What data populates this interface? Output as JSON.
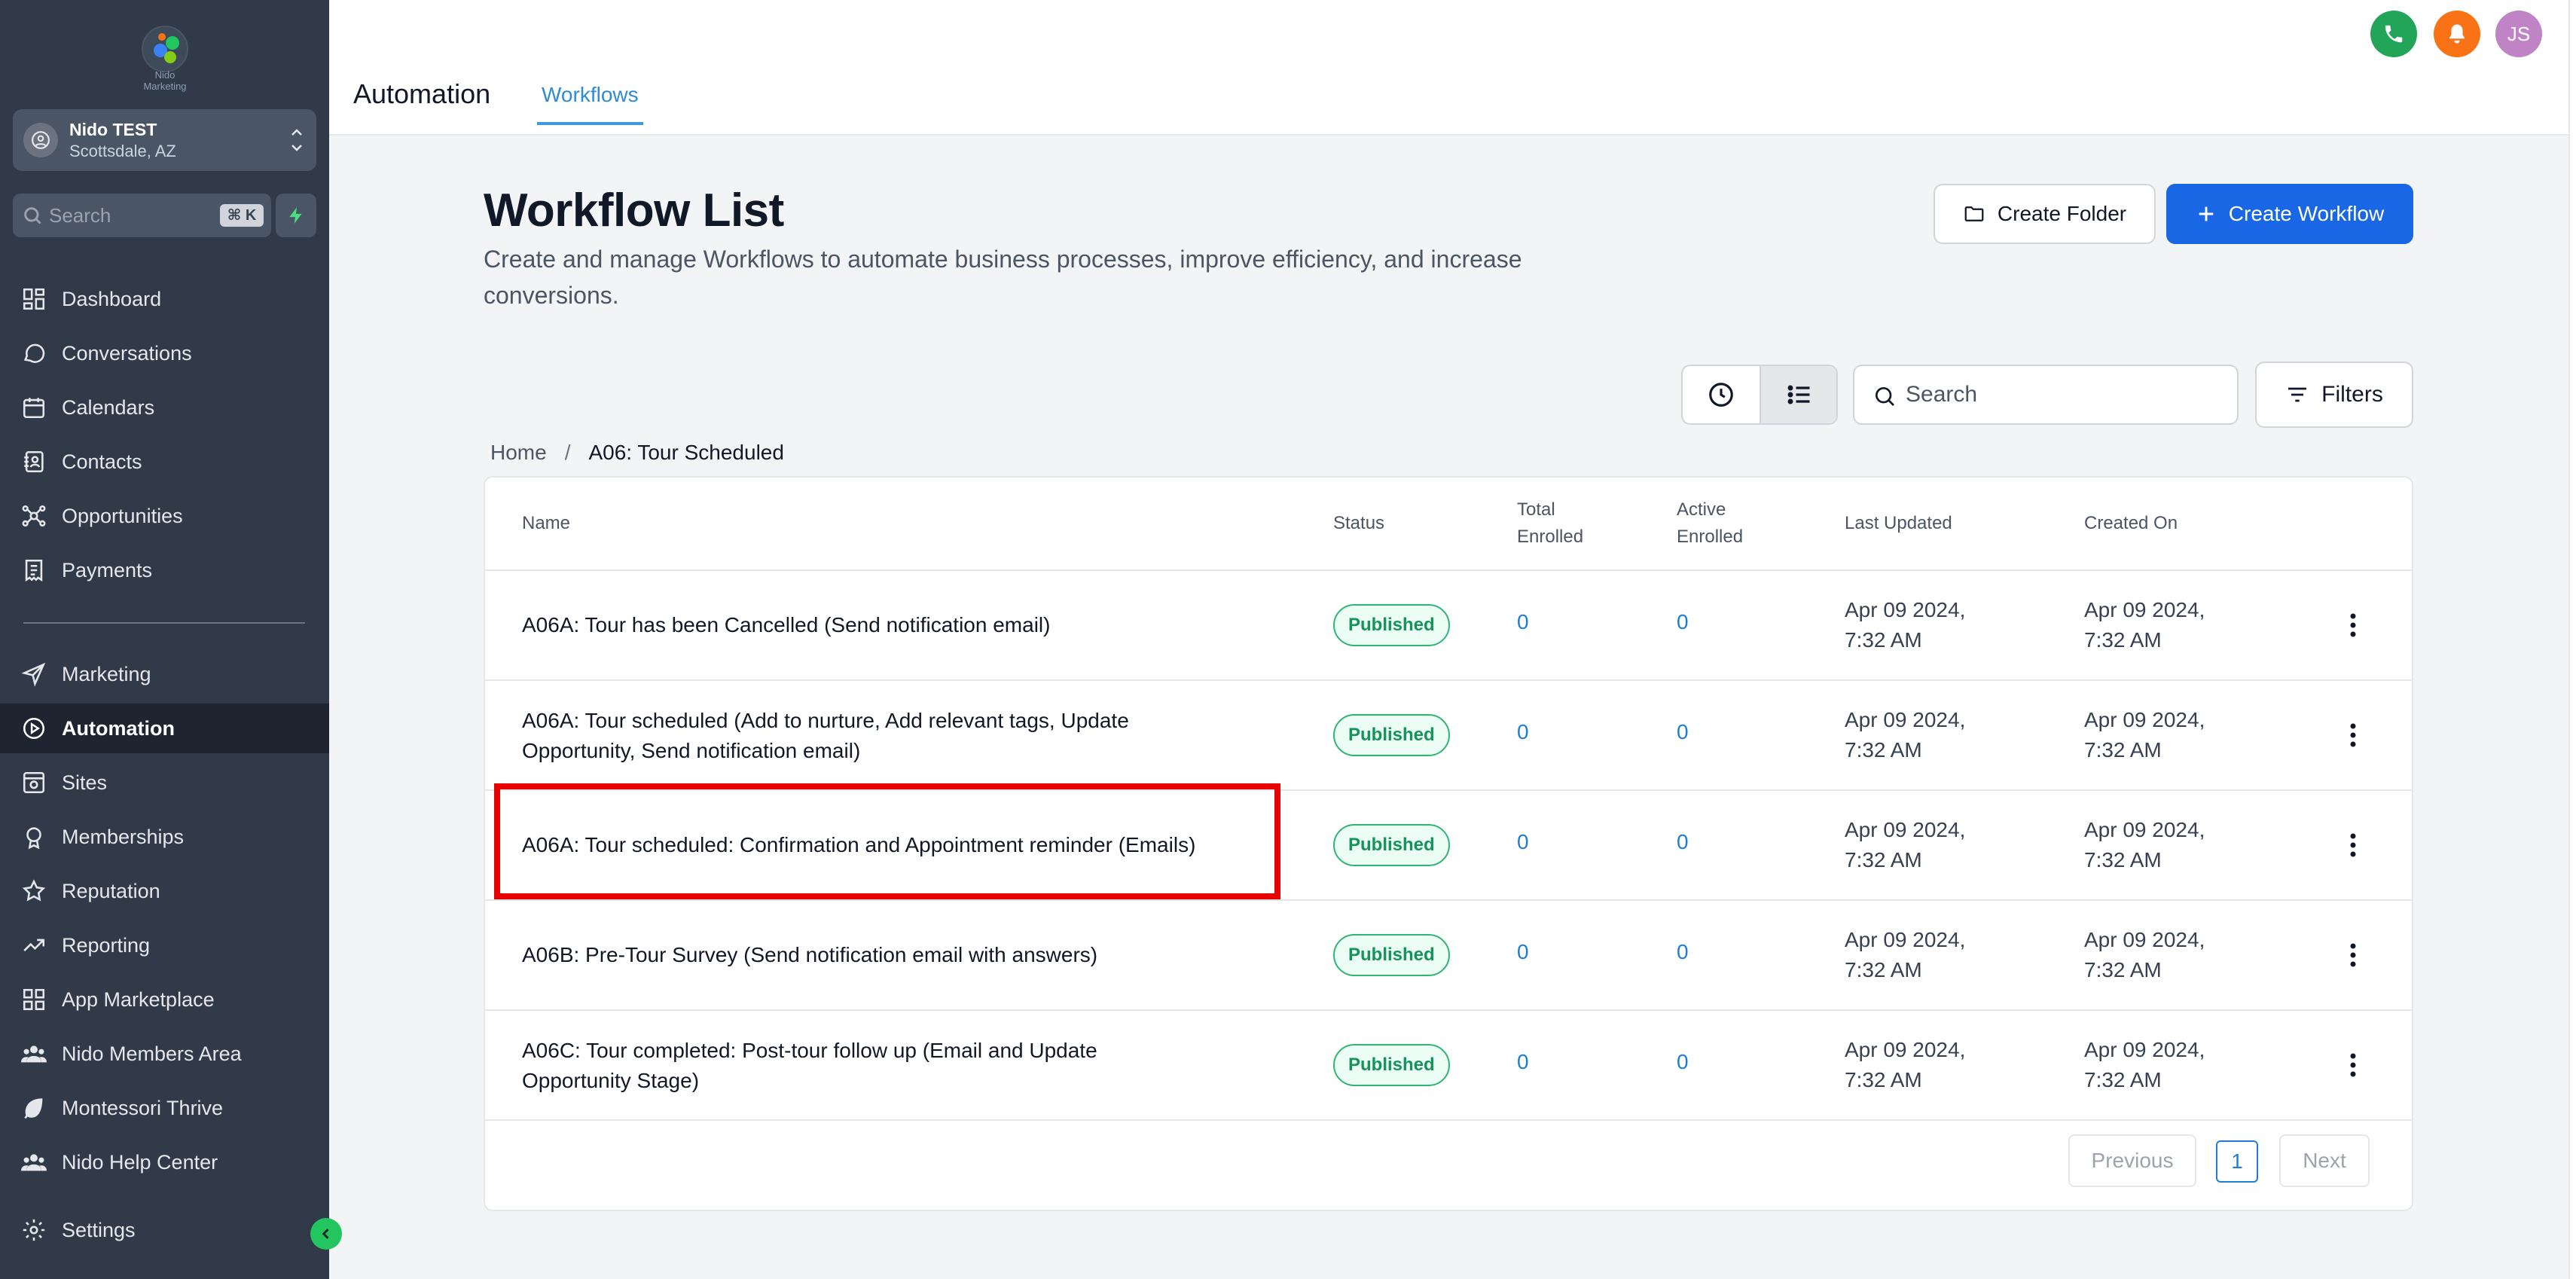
{
  "sidebar": {
    "logo_text": "Nido Marketing",
    "account": {
      "name": "Nido TEST",
      "location": "Scottsdale, AZ"
    },
    "search": {
      "label": "Search",
      "shortcut": "⌘ K"
    },
    "items_top": [
      {
        "label": "Dashboard",
        "icon": "dashboard-icon"
      },
      {
        "label": "Conversations",
        "icon": "chat-icon"
      },
      {
        "label": "Calendars",
        "icon": "calendar-icon"
      },
      {
        "label": "Contacts",
        "icon": "contacts-icon"
      },
      {
        "label": "Opportunities",
        "icon": "opportunities-icon"
      },
      {
        "label": "Payments",
        "icon": "payments-icon"
      }
    ],
    "items_bottom": [
      {
        "label": "Marketing",
        "icon": "send-icon"
      },
      {
        "label": "Automation",
        "icon": "automation-icon",
        "active": true
      },
      {
        "label": "Sites",
        "icon": "sites-icon"
      },
      {
        "label": "Memberships",
        "icon": "memberships-icon"
      },
      {
        "label": "Reputation",
        "icon": "star-icon"
      },
      {
        "label": "Reporting",
        "icon": "trend-icon"
      },
      {
        "label": "App Marketplace",
        "icon": "apps-icon"
      },
      {
        "label": "Nido Members Area",
        "icon": "users-icon"
      },
      {
        "label": "Montessori Thrive",
        "icon": "leaf-icon"
      },
      {
        "label": "Nido Help Center",
        "icon": "users-icon"
      }
    ],
    "settings_label": "Settings"
  },
  "header": {
    "title": "Automation",
    "tab": "Workflows",
    "avatar_initials": "JS",
    "colors": {
      "phone": "#22a559",
      "bell": "#f97316",
      "avatar": "#c084c6"
    }
  },
  "page": {
    "title": "Workflow List",
    "description": "Create and manage Workflows to automate business processes, improve efficiency, and increase conversions.",
    "create_folder": "Create Folder",
    "create_workflow": "Create Workflow",
    "search_placeholder": "Search",
    "filters": "Filters"
  },
  "breadcrumb": {
    "home": "Home",
    "separator": "/",
    "current": "A06: Tour Scheduled"
  },
  "table": {
    "headers": {
      "name": "Name",
      "status": "Status",
      "total_enrolled": [
        "Total",
        "Enrolled"
      ],
      "active_enrolled": [
        "Active",
        "Enrolled"
      ],
      "last_updated": "Last Updated",
      "created_on": "Created On"
    },
    "rows": [
      {
        "name": [
          "A06A: Tour has been Cancelled (Send notification email)"
        ],
        "status": "Published",
        "total": "0",
        "active": "0",
        "updated": [
          "Apr 09 2024,",
          "7:32 AM"
        ],
        "created": [
          "Apr 09 2024,",
          "7:32 AM"
        ]
      },
      {
        "name": [
          "A06A: Tour scheduled (Add to nurture, Add relevant tags, Update",
          "Opportunity, Send notification email)"
        ],
        "status": "Published",
        "total": "0",
        "active": "0",
        "updated": [
          "Apr 09 2024,",
          "7:32 AM"
        ],
        "created": [
          "Apr 09 2024,",
          "7:32 AM"
        ]
      },
      {
        "name": [
          "A06A: Tour scheduled: Confirmation and Appointment reminder (Emails)"
        ],
        "status": "Published",
        "total": "0",
        "active": "0",
        "updated": [
          "Apr 09 2024,",
          "7:32 AM"
        ],
        "created": [
          "Apr 09 2024,",
          "7:32 AM"
        ],
        "highlighted": true
      },
      {
        "name": [
          "A06B: Pre-Tour Survey (Send notification email with answers)"
        ],
        "status": "Published",
        "total": "0",
        "active": "0",
        "updated": [
          "Apr 09 2024,",
          "7:32 AM"
        ],
        "created": [
          "Apr 09 2024,",
          "7:32 AM"
        ]
      },
      {
        "name": [
          "A06C: Tour completed: Post-tour follow up (Email and Update",
          "Opportunity Stage)"
        ],
        "status": "Published",
        "total": "0",
        "active": "0",
        "updated": [
          "Apr 09 2024,",
          "7:32 AM"
        ],
        "created": [
          "Apr 09 2024,",
          "7:32 AM"
        ]
      }
    ]
  },
  "pagination": {
    "previous": "Previous",
    "page": "1",
    "next": "Next"
  }
}
